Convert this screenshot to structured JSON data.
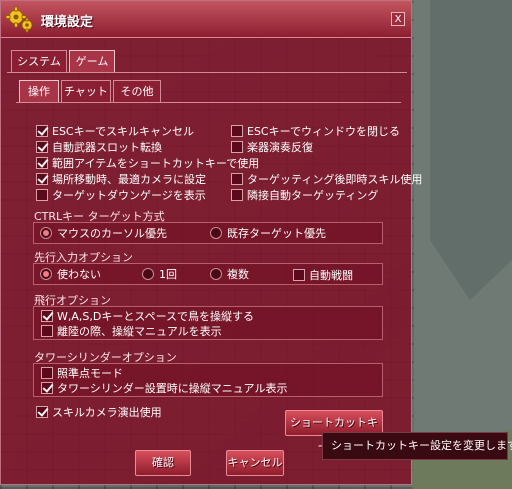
{
  "window": {
    "title": "環境設定",
    "close_label": "X"
  },
  "main_tabs": [
    {
      "label": "システム",
      "active": false
    },
    {
      "label": "ゲーム",
      "active": true
    }
  ],
  "sub_tabs": [
    {
      "label": "操作",
      "active": true
    },
    {
      "label": "チャット",
      "active": false
    },
    {
      "label": "その他",
      "active": false
    }
  ],
  "options_left": [
    {
      "label": "ESCキーでスキルキャンセル",
      "checked": true
    },
    {
      "label": "自動武器スロット転換",
      "checked": true
    },
    {
      "label": "範囲アイテムをショートカットキーで使用",
      "checked": true
    },
    {
      "label": "場所移動時、最適カメラに設定",
      "checked": true
    },
    {
      "label": "ターゲットダウンゲージを表示",
      "checked": false
    }
  ],
  "options_right": [
    {
      "label": "ESCキーでウィンドウを閉じる",
      "checked": false
    },
    {
      "label": "楽器演奏反復",
      "checked": false
    },
    {
      "label": "ターゲッティング後即時スキル使用",
      "checked": false
    },
    {
      "label": "隣接自動ターゲッティング",
      "checked": false
    }
  ],
  "ctrl_target": {
    "title": "CTRLキー ターゲット方式",
    "options": [
      {
        "label": "マウスのカーソル優先",
        "selected": true
      },
      {
        "label": "既存ターゲット優先",
        "selected": false
      }
    ]
  },
  "preinput": {
    "title": "先行入力オプション",
    "options": [
      {
        "label": "使わない",
        "selected": true
      },
      {
        "label": "1回",
        "selected": false
      },
      {
        "label": "複数",
        "selected": false
      }
    ],
    "auto_combat": {
      "label": "自動戦闘",
      "checked": false
    }
  },
  "flight": {
    "title": "飛行オプション",
    "options": [
      {
        "label": "W,A,S,Dキーとスペースで鳥を操縦する",
        "checked": true
      },
      {
        "label": "離陸の際、操縦マニュアルを表示",
        "checked": false
      }
    ]
  },
  "tower": {
    "title": "タワーシリンダーオプション",
    "options": [
      {
        "label": "照準点モード",
        "checked": false
      },
      {
        "label": "タワーシリンダー設置時に操縦マニュアル表示",
        "checked": true
      }
    ]
  },
  "skill_camera": {
    "label": "スキルカメラ演出使用",
    "checked": true
  },
  "buttons": {
    "shortcut": "ショートカットキー設定",
    "confirm": "確認",
    "cancel": "キャンセル"
  },
  "tooltip": "ショートカットキー設定を変更します。"
}
